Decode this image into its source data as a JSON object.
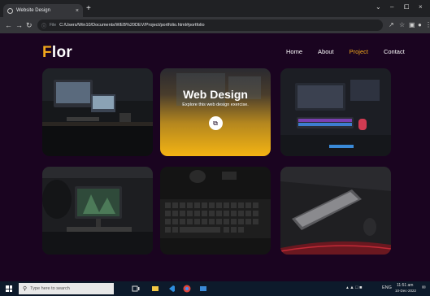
{
  "browser": {
    "tab_title": "Website Design",
    "tab_close": "×",
    "new_tab": "+",
    "url_label": "File",
    "url": "C:/Users/Win10/Documents/WEB%20DEV/Project/portfolio.html#portfolio",
    "window_controls": [
      "⌄",
      "–",
      "⧠",
      "×"
    ]
  },
  "site": {
    "logo_first": "F",
    "logo_rest": "lor",
    "nav": [
      {
        "label": "Home",
        "active": false
      },
      {
        "label": "About",
        "active": false
      },
      {
        "label": "Project",
        "active": true
      },
      {
        "label": "Contact",
        "active": false
      }
    ],
    "accent_color": "#f0a61c",
    "background_color": "#1a0420"
  },
  "portfolio": {
    "cards": [
      {
        "image": "desk-monitors-photo"
      },
      {
        "image": "web-design-photo",
        "title": "Web Design",
        "subtitle": "Explore this web design exercise.",
        "icon": "external-link-icon"
      },
      {
        "image": "gaming-setup-photo"
      },
      {
        "image": "monitor-plant-photo"
      },
      {
        "image": "mechanical-keyboard-photo"
      },
      {
        "image": "red-keyboard-photo"
      }
    ]
  },
  "taskbar": {
    "search_placeholder": "Type here to search",
    "language": "ENG",
    "time": "11:51 am",
    "date": "10-Dec-2022"
  }
}
